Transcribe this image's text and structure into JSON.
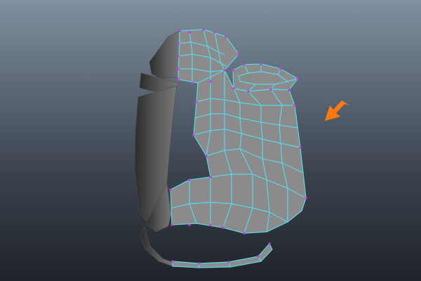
{
  "viewport": {
    "background_top": "#8090a0",
    "background_bottom": "#1f2329"
  },
  "model": {
    "object": "jug-mesh",
    "dark_side_color": "#4a4a4a",
    "lit_face_color": "#8b8b8b",
    "wireframe_color": "#5ad6e8",
    "vertex_color": "#c040e0"
  },
  "annotation": {
    "icon": "arrow-pointer-icon",
    "color": "#ff7a10"
  }
}
